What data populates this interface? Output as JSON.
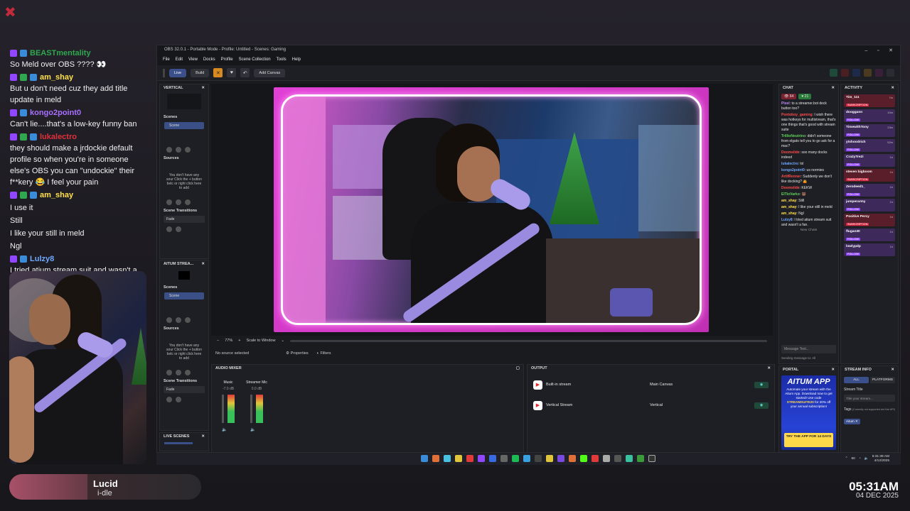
{
  "overlay": {
    "chat": [
      {
        "user": "BEASTmentality",
        "color": "#2fa84f",
        "badges": [
          "twitch-badge",
          "subscriber-badge"
        ],
        "text": "So Meld over OBS ???? 👀"
      },
      {
        "user": "am_shay",
        "color": "#ffe14b",
        "badges": [
          "twitch-badge",
          "mod-badge",
          "hype-badge"
        ],
        "text": "But u don't need cuz they add title update in meld"
      },
      {
        "user": "kongo2point0",
        "color": "#a970ff",
        "badges": [
          "twitch-badge",
          "subscriber-badge"
        ],
        "text": "Can't lie....that's a low-key funny ban"
      },
      {
        "user": "lukalectro",
        "color": "#e0303a",
        "badges": [
          "twitch-badge",
          "shield-badge",
          "sub-badge"
        ],
        "text": "they should make a jrdockie default profile so when you're in someone else's OBS you can \"undockie\" their f**kery 😂 I feel your pain"
      },
      {
        "user": "am_shay",
        "color": "#ffe14b",
        "badges": [
          "twitch-badge",
          "mod-badge",
          "hype-badge"
        ],
        "lines": [
          "I use it",
          "Still",
          "I like your still in meld",
          "Ngl"
        ]
      },
      {
        "user": "Lulzy8",
        "color": "#6fa8ff",
        "badges": [
          "twitch-badge",
          "hands-badge"
        ],
        "text": "I tried atium stream suit and wasn't a fan."
      }
    ],
    "now_playing": {
      "title": "Lucid",
      "subtitle": "i-dle"
    },
    "time": "05:31AM",
    "date": "04 DEC 2025"
  },
  "obs": {
    "window_title": "OBS 32.0.1 - Portable Mode - Profile: Untitled - Scenes: Gaming",
    "menu": [
      "File",
      "Edit",
      "View",
      "Docks",
      "Profile",
      "Scene Collection",
      "Tools",
      "Help"
    ],
    "toolbar": {
      "live": "Live",
      "build": "Build",
      "add_canvas": "Add Canvas"
    },
    "vertical_dock": {
      "title": "VERTICAL",
      "scenes_label": "Scenes",
      "scene": "Scene",
      "sources_label": "Sources",
      "empty_sources": "You don't have any sour Click the + button belc or right click here to add",
      "transitions_label": "Scene Transitions",
      "transition": "Fade"
    },
    "aitum_dock": {
      "title": "AITUM STREA...",
      "scenes_label": "Scenes",
      "scene": "Scene",
      "sources_label": "Sources",
      "empty_sources": "You don't have any sour Click the + button belc or right click here to add",
      "transitions_label": "Scene Transitions",
      "transition": "Fade"
    },
    "live_scenes": "LIVE SCENES",
    "zoom": {
      "percent": "77%",
      "mode": "Scale to Window"
    },
    "source_bar": {
      "status": "No source selected",
      "properties": "Properties",
      "filters": "Filters"
    },
    "mixer": {
      "title": "AUDIO MIXER",
      "channels": [
        {
          "name": "Music",
          "db": "-7.0 dB"
        },
        {
          "name": "Streamer Mic",
          "db": "0.0 dB"
        }
      ]
    },
    "output": {
      "title": "OUTPUT",
      "rows": [
        {
          "name": "Built-in stream",
          "canvas": "Main Canvas"
        },
        {
          "name": "Vertical Stream",
          "canvas": "Vertical"
        }
      ]
    },
    "chat": {
      "title": "CHAT",
      "viewers": "64",
      "followers": "21",
      "messages": [
        {
          "user": "Pixel",
          "cls": "u-purple",
          "text": ": to a streamer.bot deck button too?"
        },
        {
          "user": "Pontoboy_gaming",
          "cls": "u-red",
          "text": ": I wish there was hotkeys for multistream, that's one things that's good with stream suite"
        },
        {
          "user": "TrillioNeutrino",
          "cls": "u-green",
          "text": ": didn't someone from elgato tell you to go ask for a mac?"
        },
        {
          "user": "Doomslide",
          "cls": "u-red",
          "text": ": soo many docks indeed"
        },
        {
          "user": "lukalectro",
          "cls": "u-blue",
          "text": ": lol"
        },
        {
          "user": "kongo2point0",
          "cls": "u-blue",
          "text": ": us normies"
        },
        {
          "user": "ArtifRenner",
          "cls": "u-red",
          "text": ": Suddenly we don't like docking? 🤷"
        },
        {
          "user": "Doomslide",
          "cls": "u-red",
          "text": ": KEKW"
        },
        {
          "user": "ElTioVarko",
          "cls": "u-green",
          "text": ": 🐻"
        },
        {
          "user": "am_shay",
          "cls": "u-yellow",
          "text": ": Still"
        },
        {
          "user": "am_shay",
          "cls": "u-yellow",
          "text": ": I like your still in meld"
        },
        {
          "user": "am_shay",
          "cls": "u-yellow",
          "text": ": Ngl"
        },
        {
          "user": "Lulzy8",
          "cls": "u-blue",
          "text": ": I tried atium stream suit and wasn't a fan."
        }
      ],
      "new_chats": "New Chats",
      "input_placeholder": "Message Text...",
      "sending_to": "Sending message to: All"
    },
    "activity": {
      "title": "ACTIVITY",
      "items": [
        {
          "name": "Tim_111",
          "tag": "SUBSCRIPTION",
          "time": "7m",
          "type": "sub"
        },
        {
          "name": "dooggann",
          "tag": "FOLLOW",
          "time": "10m",
          "type": "follow"
        },
        {
          "name": "TimewithTony",
          "tag": "FOLLOW",
          "time": "23m",
          "type": "follow"
        },
        {
          "name": "ytshoodrich",
          "tag": "FOLLOW",
          "time": "52m",
          "type": "follow"
        },
        {
          "name": "Cra2yTre2i",
          "tag": "FOLLOW",
          "time": "1h",
          "type": "follow"
        },
        {
          "name": "steven bigboom",
          "tag": "SUBSCRIPTION",
          "time": "1h",
          "type": "sub"
        },
        {
          "name": "Zerodeed1_",
          "tag": "FOLLOW",
          "time": "1h",
          "type": "follow"
        },
        {
          "name": "jumperarmy",
          "tag": "FOLLOW",
          "time": "1h",
          "type": "follow"
        },
        {
          "name": "Positive Percy",
          "tag": "SUBSCRIPTION",
          "time": "1h",
          "type": "sub"
        },
        {
          "name": "flugan30",
          "tag": "FOLLOW",
          "time": "1h",
          "type": "follow"
        },
        {
          "name": "lowlypdp",
          "tag": "FOLLOW",
          "time": "1h",
          "type": "follow"
        }
      ]
    },
    "portal": {
      "title": "PORTAL",
      "logo": "AITUM APP",
      "body_pre": "Automate your stream with the Aitum App. Download now to get started! Use code ",
      "code": "STREAMSUITE20",
      "body_post": " for 20% off your annual subscription!",
      "cta": "TRY THE APP FOR 14 DAYS"
    },
    "stream_info": {
      "title": "STREAM INFO",
      "tab_all": "ALL",
      "tab_platforms": "PLATFORMS",
      "stream_title_label": "Stream Title",
      "stream_title_placeholder": "Title your stream...",
      "tags_label": "Tags",
      "tags_note": "(Currently not supported via Kick API)",
      "tag": "Aitum"
    },
    "taskbar": {
      "tray_temp": "60",
      "clock_time": "5:31:39 AM",
      "clock_date": "4/12/2025"
    }
  }
}
